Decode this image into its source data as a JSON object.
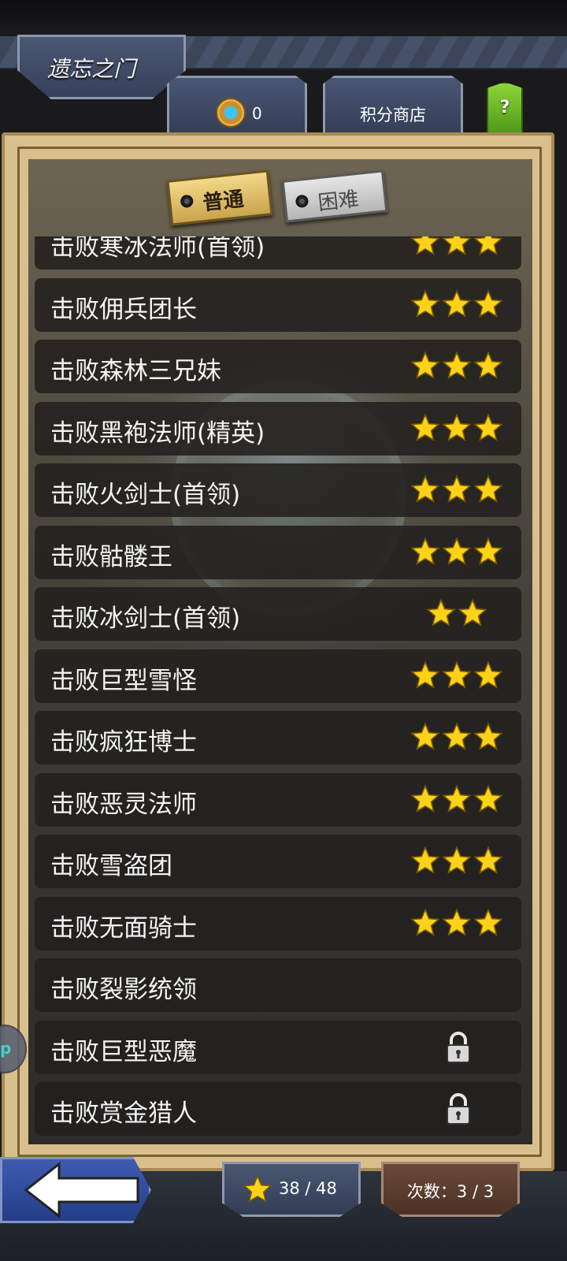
{
  "header": {
    "title": "遗忘之门",
    "points_value": "0",
    "shop_label": "积分商店",
    "help_label": "?"
  },
  "difficulty_tabs": {
    "normal": "普通",
    "hard": "困难",
    "selected": "normal"
  },
  "list": {
    "rows": [
      {
        "label": "击败寒冰法师(首领)",
        "stars": 3,
        "locked": false
      },
      {
        "label": "击败佣兵团长",
        "stars": 3,
        "locked": false
      },
      {
        "label": "击败森林三兄妹",
        "stars": 3,
        "locked": false
      },
      {
        "label": "击败黑袍法师(精英)",
        "stars": 3,
        "locked": false
      },
      {
        "label": "击败火剑士(首领)",
        "stars": 3,
        "locked": false
      },
      {
        "label": "击败骷髅王",
        "stars": 3,
        "locked": false
      },
      {
        "label": "击败冰剑士(首领)",
        "stars": 2,
        "locked": false
      },
      {
        "label": "击败巨型雪怪",
        "stars": 3,
        "locked": false
      },
      {
        "label": "击败疯狂博士",
        "stars": 3,
        "locked": false
      },
      {
        "label": "击败恶灵法师",
        "stars": 3,
        "locked": false
      },
      {
        "label": "击败雪盗团",
        "stars": 3,
        "locked": false
      },
      {
        "label": "击败无面骑士",
        "stars": 3,
        "locked": false
      },
      {
        "label": "击败裂影统领",
        "stars": 0,
        "locked": false
      },
      {
        "label": "击败巨型恶魔",
        "stars": 0,
        "locked": true
      },
      {
        "label": "击败赏金猎人",
        "stars": 0,
        "locked": true
      }
    ]
  },
  "footer": {
    "stars_total": "38 / 48",
    "attempts": "次数：3 / 3"
  },
  "side_bubble_text": "p",
  "icons": {
    "star": "star-icon",
    "lock": "lock-icon",
    "medal": "medal-icon",
    "back": "back-arrow-icon"
  },
  "colors": {
    "star_fill": "#ffd21a",
    "row_bg": "#22201e",
    "frame": "#d8bf8c",
    "help_green": "#6cbf2a"
  }
}
